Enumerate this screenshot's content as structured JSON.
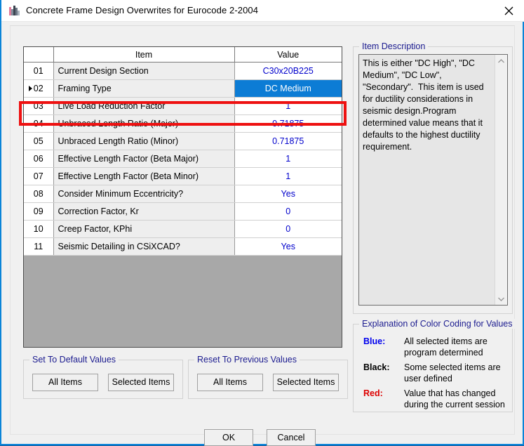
{
  "window": {
    "title": "Concrete Frame Design Overwrites for Eurocode 2-2004",
    "icon": "csi-app-icon",
    "close_label": "✕",
    "accent": "#0a84d8"
  },
  "grid": {
    "headers": {
      "num": "",
      "item": "Item",
      "value": "Value"
    },
    "selected_row_index": 1,
    "rows": [
      {
        "num": "01",
        "item": "Current Design Section",
        "value": "C30x20B225"
      },
      {
        "num": "02",
        "item": "Framing Type",
        "value": "DC Medium"
      },
      {
        "num": "03",
        "item": "Live Load Reduction Factor",
        "value": "1"
      },
      {
        "num": "04",
        "item": "Unbraced Length Ratio (Major)",
        "value": "0.71875"
      },
      {
        "num": "05",
        "item": "Unbraced Length Ratio (Minor)",
        "value": "0.71875"
      },
      {
        "num": "06",
        "item": "Effective Length Factor (Beta Major)",
        "value": "1"
      },
      {
        "num": "07",
        "item": "Effective Length Factor (Beta Minor)",
        "value": "1"
      },
      {
        "num": "08",
        "item": "Consider Minimum Eccentricity?",
        "value": "Yes"
      },
      {
        "num": "09",
        "item": "Correction Factor, Kr",
        "value": "0"
      },
      {
        "num": "10",
        "item": "Creep Factor, KPhi",
        "value": "0"
      },
      {
        "num": "11",
        "item": "Seismic Detailing in CSiXCAD?",
        "value": "Yes"
      }
    ],
    "value_color": "#0000cc",
    "selection_color": "#0c7cd5",
    "empty_area_color": "#a8a8a8"
  },
  "annotation": {
    "type": "red-highlight-box",
    "target_row": "02",
    "color": "#ee1111"
  },
  "item_description": {
    "legend": "Item Description",
    "text": "This is either \"DC High\", \"DC Medium\", \"DC Low\",  \"Secondary\".  This item is used for ductility considerations in seismic design.Program determined value means that it defaults to the highest ductility requirement."
  },
  "color_coding": {
    "legend": "Explanation of Color Coding for Values",
    "entries": [
      {
        "key": "Blue:",
        "desc": "All selected items are program determined",
        "color": "#0000ee"
      },
      {
        "key": "Black:",
        "desc": "Some selected items are user defined",
        "color": "#000000"
      },
      {
        "key": "Red:",
        "desc": "Value that has changed during the current session",
        "color": "#dd0000"
      }
    ]
  },
  "set_to_default": {
    "legend": "Set To Default Values",
    "all_items": "All Items",
    "selected_items": "Selected Items"
  },
  "reset_to_previous": {
    "legend": "Reset To Previous Values",
    "all_items": "All Items",
    "selected_items": "Selected Items"
  },
  "dialog_buttons": {
    "ok": "OK",
    "cancel": "Cancel"
  }
}
